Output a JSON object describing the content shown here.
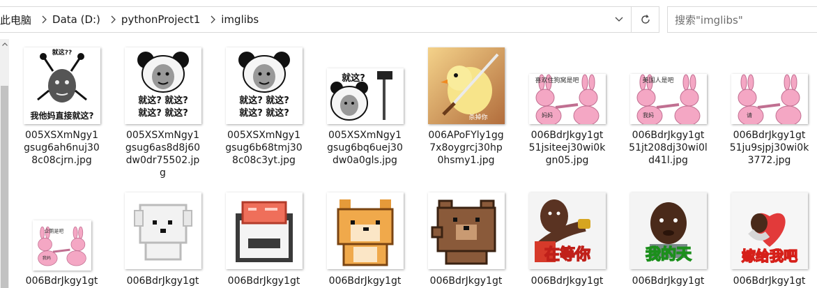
{
  "address": {
    "crumbs": [
      "此电脑",
      "Data (D:)",
      "pythonProject1",
      "imglibs"
    ]
  },
  "search": {
    "placeholder": "搜索\"imglibs\""
  },
  "files": [
    {
      "name_lines": [
        "005XSXmNgy1",
        "gsug6ah6nuj30",
        "8c08cjrn.jpg"
      ],
      "caption": "我他妈直接就这?",
      "caption2": "就这??",
      "icon": "meme-face-antenna"
    },
    {
      "name_lines": [
        "005XSXmNgy1",
        "gsug6as8d8j60",
        "dw0dr75502.jp",
        "g"
      ],
      "caption": "就这? 就这? 就这? 就这?",
      "icon": "panda-meme"
    },
    {
      "name_lines": [
        "005XSXmNgy1",
        "gsug6b68tmj30",
        "8c08c3yt.jpg"
      ],
      "caption": "就这? 就这?",
      "caption2": "就这? 就这?",
      "caption3": "就这?",
      "icon": "panda-meme"
    },
    {
      "name_lines": [
        "005XSXmNgy1",
        "gsug6bq6uej30",
        "dw0a0gls.jpg"
      ],
      "caption": "就这?",
      "icon": "panda-hammer"
    },
    {
      "name_lines": [
        "006APoFYly1gg",
        "7x8oygrcj30hp",
        "0hsmy1.jpg"
      ],
      "caption": "杀掉你",
      "icon": "duck-knife"
    },
    {
      "name_lines": [
        "006BdrJkgy1gt",
        "51jsiteej30wi0k",
        "gn05.jpg"
      ],
      "caption": "喜欢住狗窝是吧",
      "caption2": "妈妈",
      "icon": "rabbit-pair"
    },
    {
      "name_lines": [
        "006BdrJkgy1gt",
        "51jt208dj30wi0l",
        "d41l.jpg"
      ],
      "caption": "美国人是吧",
      "caption2": "我妈",
      "icon": "rabbit-pair"
    },
    {
      "name_lines": [
        "006BdrJkgy1gt",
        "51ju9sjpj30wi0k",
        "3772.jpg"
      ],
      "caption": "",
      "caption2": "请",
      "icon": "rabbit-pair"
    },
    {
      "name_lines": [
        "006BdrJkgy1gt"
      ],
      "caption": "企鹅是吧",
      "caption2": "我妈",
      "icon": "rabbit-pair"
    },
    {
      "name_lines": [
        "006BdrJkgy1gt"
      ],
      "caption": "",
      "icon": "pixel-dog"
    },
    {
      "name_lines": [
        "006BdrJkgy1gt"
      ],
      "caption": "",
      "icon": "pixel-sushi"
    },
    {
      "name_lines": [
        "006BdrJkgy1gt"
      ],
      "caption": "",
      "icon": "pixel-shiba"
    },
    {
      "name_lines": [
        "006BdrJkgy1gt"
      ],
      "caption": "",
      "icon": "pixel-bear"
    },
    {
      "name_lines": [
        "006BdrJkgy1gt"
      ],
      "caption": "在等你",
      "icon": "man-watch"
    },
    {
      "name_lines": [
        "006BdrJkgy1gt"
      ],
      "caption": "我的天",
      "icon": "man-face"
    },
    {
      "name_lines": [
        "006BdrJkgy1gt"
      ],
      "caption": "嫁给我吧",
      "icon": "man-heart"
    }
  ],
  "colors": {
    "pink": "#f4a7c4",
    "red_caption": "#e0301e",
    "green_caption": "#3fbf3f"
  }
}
